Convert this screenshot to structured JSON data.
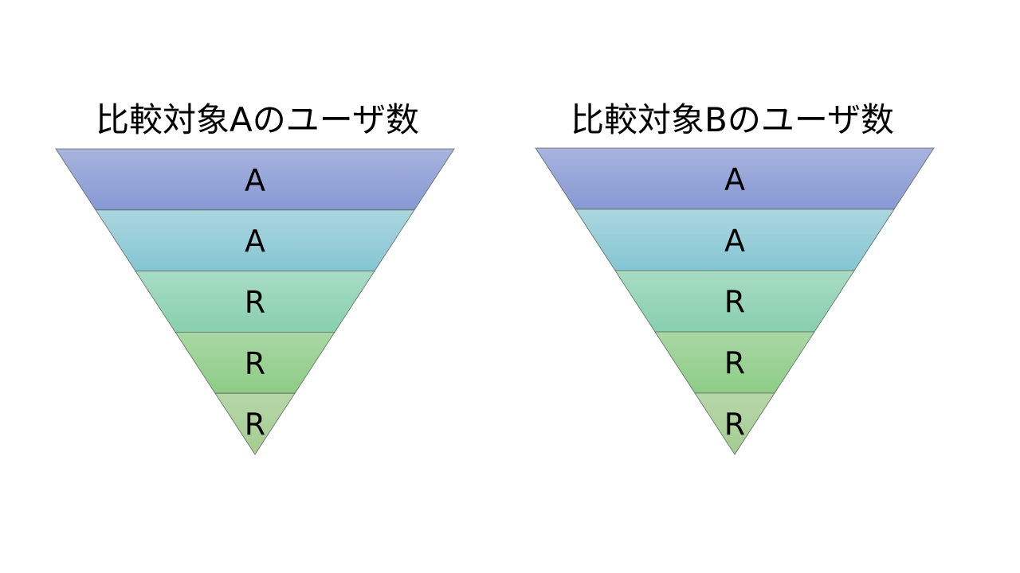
{
  "titles": {
    "a": "比較対象Aのユーザ数",
    "b": "比較対象Bのユーザ数"
  },
  "funnels": [
    {
      "name": "funnel-a",
      "stages": [
        {
          "label": "A",
          "color_top": "#a7b4de",
          "color_bottom": "#8799d4"
        },
        {
          "label": "A",
          "color_top": "#abd6df",
          "color_bottom": "#84c6d3"
        },
        {
          "label": "R",
          "color_top": "#a8dcc4",
          "color_bottom": "#87cfae"
        },
        {
          "label": "R",
          "color_top": "#a9d8a4",
          "color_bottom": "#8dcc86"
        },
        {
          "label": "R",
          "color_top": "#b6d7a8",
          "color_bottom": "#a5cc93"
        }
      ]
    },
    {
      "name": "funnel-b",
      "stages": [
        {
          "label": "A",
          "color_top": "#a7b4de",
          "color_bottom": "#8799d4"
        },
        {
          "label": "A",
          "color_top": "#abd6df",
          "color_bottom": "#84c6d3"
        },
        {
          "label": "R",
          "color_top": "#a8dcc4",
          "color_bottom": "#87cfae"
        },
        {
          "label": "R",
          "color_top": "#a9d8a4",
          "color_bottom": "#8dcc86"
        },
        {
          "label": "R",
          "color_top": "#b6d7a8",
          "color_bottom": "#a5cc93"
        }
      ]
    }
  ],
  "colors": {
    "stroke": "#5f6b5f"
  }
}
